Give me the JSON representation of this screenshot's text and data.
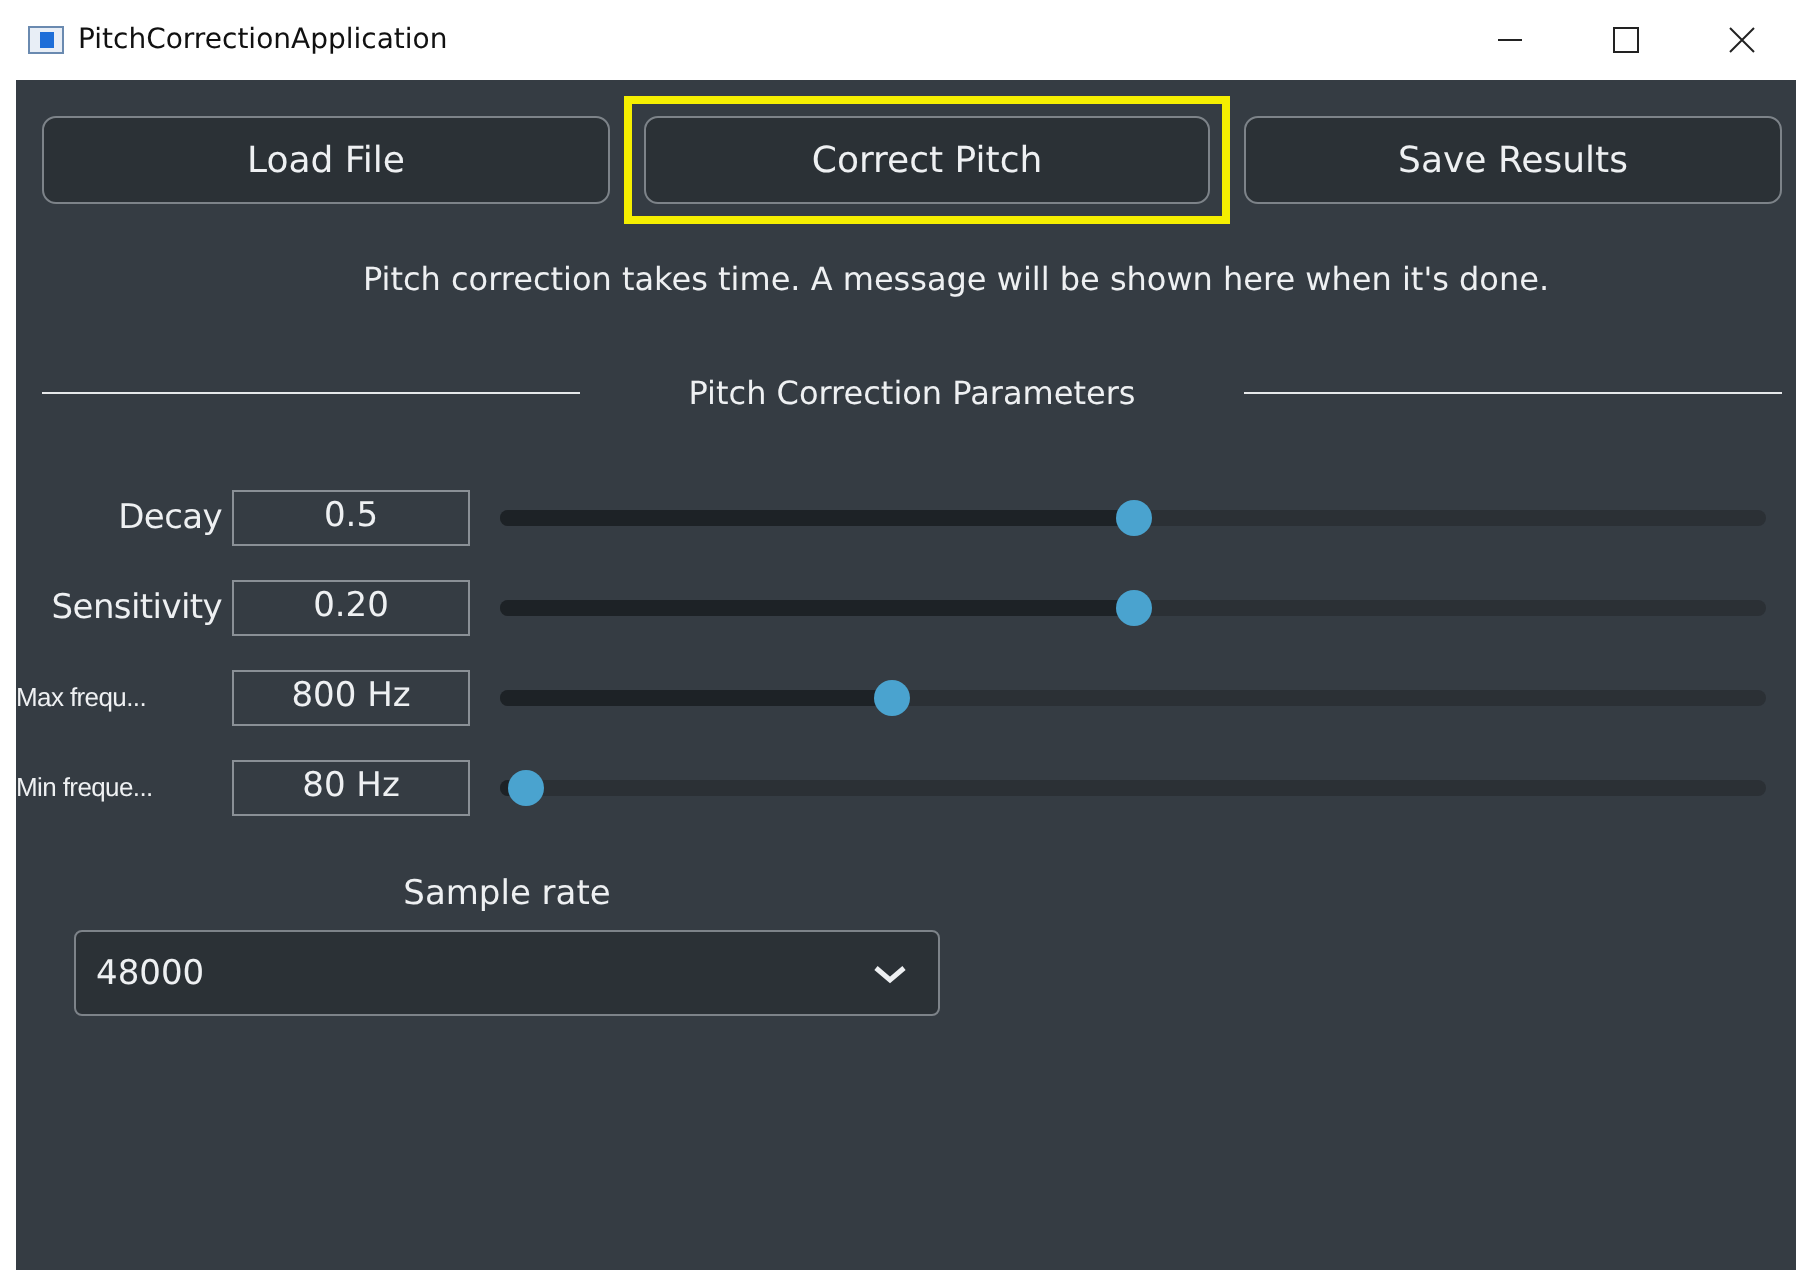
{
  "window": {
    "title": "PitchCorrectionApplication"
  },
  "buttons": [
    {
      "label": "Load File",
      "highlighted": false
    },
    {
      "label": "Correct Pitch",
      "highlighted": true
    },
    {
      "label": "Save Results",
      "highlighted": false
    }
  ],
  "message": "Pitch correction takes time. A message will be shown here when it's done.",
  "section_title": "Pitch Correction Parameters",
  "parameters": [
    {
      "name": "Decay",
      "value": "0.5",
      "level": 0.5,
      "small": false
    },
    {
      "name": "Sensitivity",
      "value": "0.20",
      "level": 0.5,
      "small": false
    },
    {
      "name": "Max frequ...",
      "value": "800 Hz",
      "level": 0.31,
      "small": true
    },
    {
      "name": "Min freque...",
      "value": "80 Hz",
      "level": 0.02,
      "small": true
    }
  ],
  "sample_rate": {
    "label": "Sample rate",
    "value": "48000"
  }
}
